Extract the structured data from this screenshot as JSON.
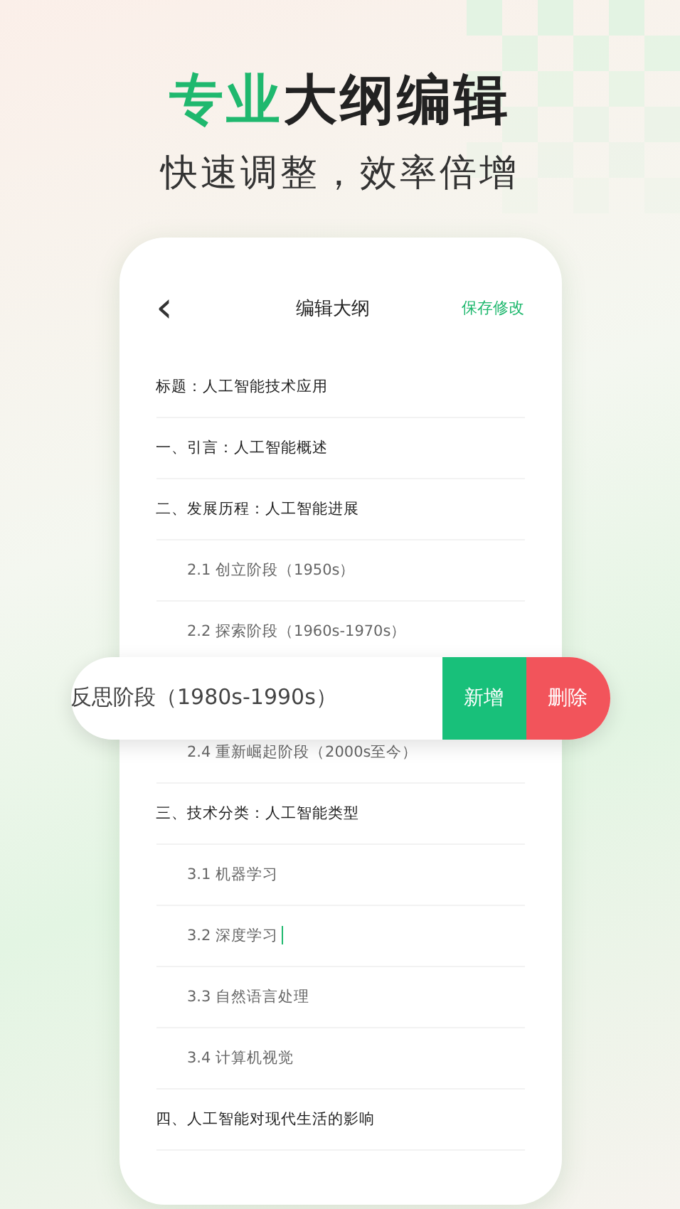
{
  "headline": {
    "highlight": "专业",
    "rest": "大纲编辑"
  },
  "subtitle": "快速调整，效率倍增",
  "screen": {
    "back_icon": "‹",
    "title": "编辑大纲",
    "save": "保存修改",
    "rows": [
      {
        "kind": "heading",
        "text": "标题：人工智能技术应用",
        "focused": false
      },
      {
        "kind": "heading",
        "text": "一、引言：人工智能概述",
        "focused": false
      },
      {
        "kind": "heading",
        "text": "二、发展历程：人工智能进展",
        "focused": false
      },
      {
        "kind": "sub",
        "text": "2.1 创立阶段（1950s）",
        "focused": false
      },
      {
        "kind": "sub",
        "text": "2.2 探索阶段（1960s-1970s）",
        "focused": false
      },
      {
        "kind": "swiped",
        "text": "反思阶段（1980s-1990s）",
        "focused": false,
        "actions": [
          {
            "label": "新增",
            "kind": "add"
          },
          {
            "label": "删除",
            "kind": "delete"
          }
        ]
      },
      {
        "kind": "sub",
        "text": "2.4 重新崛起阶段（2000s至今）",
        "focused": false
      },
      {
        "kind": "heading",
        "text": "三、技术分类：人工智能类型",
        "focused": false
      },
      {
        "kind": "sub",
        "text": "3.1 机器学习",
        "focused": false
      },
      {
        "kind": "sub",
        "text": "3.2 深度学习",
        "focused": true
      },
      {
        "kind": "sub",
        "text": "3.3 自然语言处理",
        "focused": false
      },
      {
        "kind": "sub",
        "text": "3.4 计算机视觉",
        "focused": false
      },
      {
        "kind": "heading",
        "text": "四、人工智能对现代生活的影响",
        "focused": false
      }
    ]
  }
}
